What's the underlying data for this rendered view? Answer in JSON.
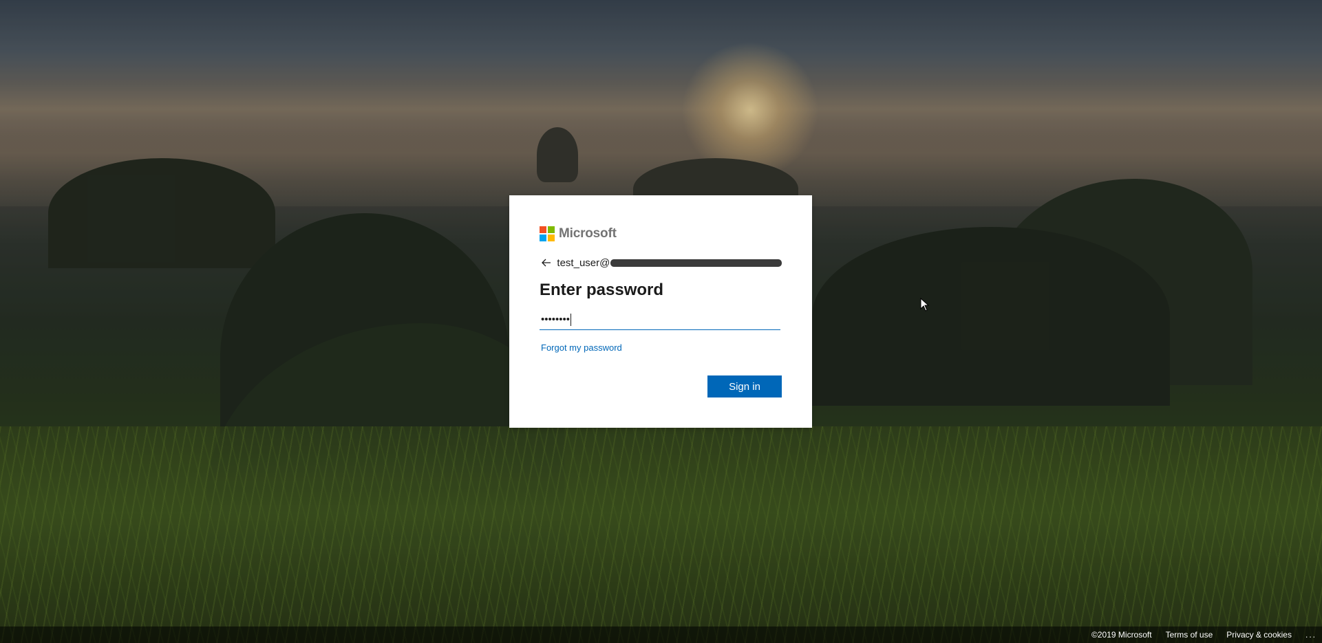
{
  "brand": {
    "name": "Microsoft",
    "colors": {
      "red": "#f25022",
      "green": "#7fba00",
      "blue": "#00a4ef",
      "yellow": "#ffb900"
    }
  },
  "identity": {
    "back_icon": "arrow-left-icon",
    "email_visible": "test_user@",
    "email_redacted": true
  },
  "form": {
    "title": "Enter password",
    "password_masked": "••••••••",
    "forgot_link": "Forgot my password",
    "submit_label": "Sign in",
    "accent_color": "#0067b8"
  },
  "footer": {
    "copyright": "©2019 Microsoft",
    "terms": "Terms of use",
    "privacy": "Privacy & cookies",
    "more": "..."
  },
  "cursor_icon": "mouse-pointer-icon"
}
